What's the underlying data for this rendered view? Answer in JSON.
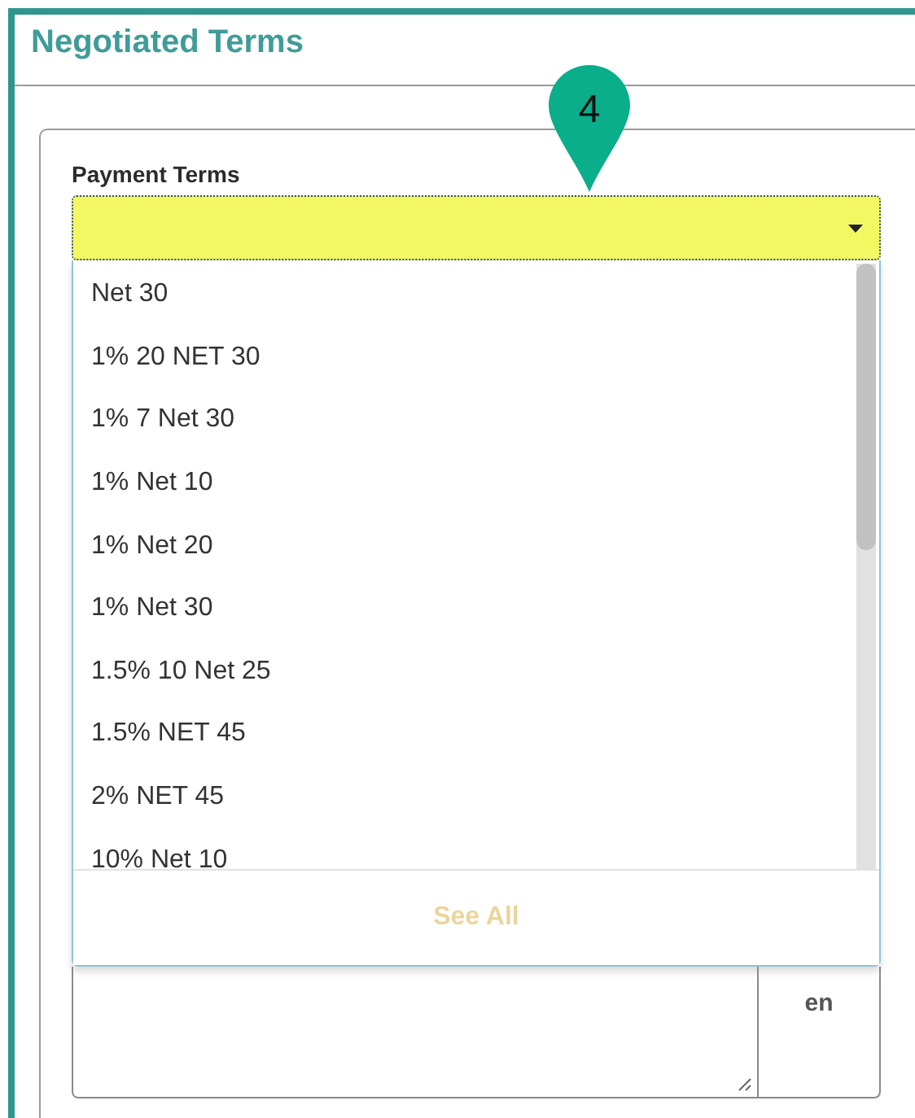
{
  "section": {
    "title": "Negotiated Terms"
  },
  "step_marker": {
    "label": "4"
  },
  "payment_terms": {
    "label": "Payment Terms",
    "open": true,
    "options": [
      {
        "label": "Net 30"
      },
      {
        "label": "1% 20 NET 30"
      },
      {
        "label": "1% 7 Net 30"
      },
      {
        "label": "1% Net 10"
      },
      {
        "label": "1% Net 20"
      },
      {
        "label": "1% Net 30"
      },
      {
        "label": "1.5% 10 Net 25"
      },
      {
        "label": "1.5% NET 45"
      },
      {
        "label": "2% NET 45"
      },
      {
        "label": "10% Net 10"
      }
    ],
    "see_all": {
      "label": "See All",
      "disabled": true
    }
  },
  "text_area": {
    "language": "en"
  }
}
